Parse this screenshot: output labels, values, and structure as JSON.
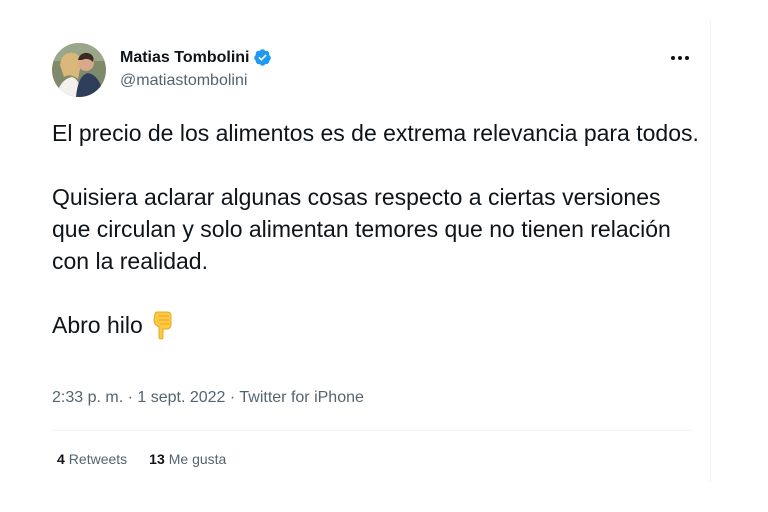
{
  "author": {
    "display_name": "Matias Tombolini",
    "handle": "@matiastombolini",
    "verified": true,
    "verified_color": "#1d9bf0",
    "avatar_icon": "profile-photo"
  },
  "tweet": {
    "paragraphs": [
      "El precio de los alimentos es de extrema relevancia para todos.",
      "Quisiera aclarar algunas cosas respecto a ciertas versiones que circulan y solo alimentan temores que no tienen relación con la realidad.",
      "Abro hilo"
    ],
    "emoji_icon": "backhand-index-pointing-down"
  },
  "meta": {
    "time": "2:33 p. m.",
    "separator": " · ",
    "date": "1 sept. 2022",
    "source": "Twitter for iPhone"
  },
  "stats": {
    "retweets_count": "4",
    "retweets_label": "Retweets",
    "likes_count": "13",
    "likes_label": "Me gusta"
  },
  "more_icon": "more-horizontal-icon"
}
